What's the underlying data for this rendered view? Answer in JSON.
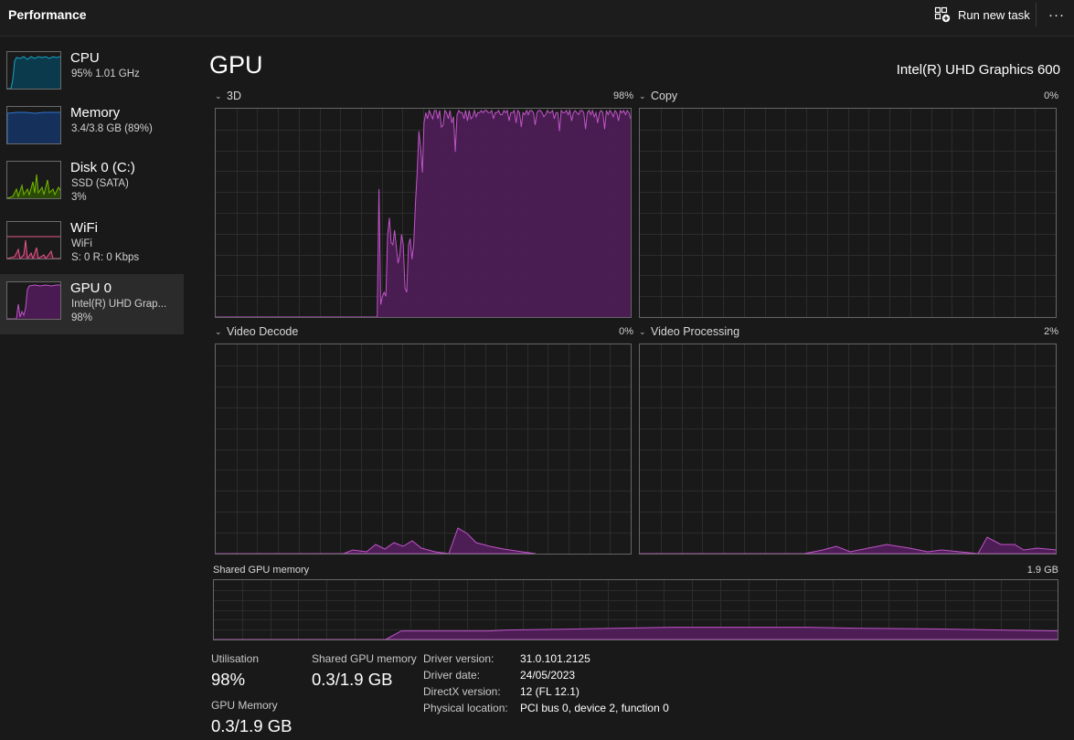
{
  "header": {
    "title": "Performance",
    "run_new_task": "Run new task",
    "more": "···",
    "run_icon": "run-task-icon",
    "more_icon": "more-options-icon"
  },
  "sidebar": {
    "items": [
      {
        "name": "CPU",
        "line1": "95% 1.01 GHz",
        "line2": "",
        "color": "#17a2c7"
      },
      {
        "name": "Memory",
        "line1": "3.4/3.8 GB (89%)",
        "line2": "",
        "color": "#2f74d1"
      },
      {
        "name": "Disk 0 (C:)",
        "line1": "SSD (SATA)",
        "line2": "3%",
        "color": "#76b900"
      },
      {
        "name": "WiFi",
        "line1": "WiFi",
        "line2": "S: 0 R: 0 Kbps",
        "color": "#e45a8b"
      },
      {
        "name": "GPU 0",
        "line1": "Intel(R) UHD Grap...",
        "line2": "98%",
        "color": "#c054c8"
      }
    ]
  },
  "main": {
    "title": "GPU",
    "model": "Intel(R) UHD Graphics 600",
    "accent": "#c054c8",
    "graphs": [
      {
        "title": "3D",
        "percent": "98%",
        "values": [
          0,
          0,
          0,
          0,
          0,
          0,
          0,
          0,
          0,
          0,
          0,
          0,
          0,
          0,
          0,
          0,
          0,
          0,
          0,
          0,
          0,
          0,
          0,
          0,
          0,
          0,
          0,
          0,
          0,
          0,
          0,
          0,
          0,
          0,
          0,
          0,
          0,
          0,
          0,
          0,
          0,
          0,
          0,
          0,
          0,
          0,
          0,
          0,
          0,
          0,
          0,
          0,
          0,
          0,
          0,
          0,
          0,
          0,
          0,
          0,
          0,
          0,
          0,
          0,
          0,
          0,
          0,
          0,
          0,
          0,
          0,
          0,
          0,
          0,
          0,
          0,
          0,
          0,
          0,
          0,
          0,
          0,
          0,
          0,
          0,
          0,
          0,
          0,
          0,
          0,
          0,
          0,
          0,
          0,
          62,
          6,
          10,
          12,
          10,
          40,
          48,
          36,
          35,
          42,
          34,
          26,
          30,
          40,
          35,
          14,
          12,
          35,
          38,
          28,
          35,
          55,
          70,
          90,
          82,
          70,
          94,
          99,
          96,
          100,
          98,
          96,
          100,
          100,
          96,
          100,
          92,
          93,
          100,
          99,
          96,
          100,
          94,
          97,
          80,
          98,
          100,
          99,
          99,
          96,
          100,
          95,
          100,
          96,
          97,
          100,
          97,
          99,
          99,
          100,
          99,
          100,
          100,
          99,
          99,
          100,
          96,
          99,
          99,
          100,
          98,
          98,
          100,
          99,
          100,
          95,
          99,
          99,
          100,
          94,
          100,
          99,
          92,
          99,
          98,
          100,
          98,
          100,
          100,
          99,
          93,
          99,
          100,
          100,
          99,
          97,
          98,
          100,
          99,
          99,
          100,
          96,
          99,
          99,
          90,
          100,
          99,
          99,
          100,
          98,
          100,
          95,
          99,
          100,
          99,
          98,
          100,
          100,
          99,
          91,
          99,
          100,
          98,
          100,
          97,
          99,
          94,
          99,
          100,
          99,
          91,
          100,
          98,
          100,
          99,
          97,
          100,
          99,
          95,
          100,
          99,
          100,
          98,
          100,
          99,
          96
        ]
      },
      {
        "title": "Copy",
        "percent": "0%",
        "values": []
      },
      {
        "title": "Video Decode",
        "percent": "0%",
        "values": [
          0,
          0,
          0,
          0,
          0,
          0,
          0,
          0,
          0,
          0,
          0,
          0,
          0,
          0,
          0,
          0,
          0,
          0,
          0,
          0,
          0,
          0,
          0,
          0,
          0,
          0,
          0,
          0,
          0,
          0,
          0,
          0,
          0,
          0,
          0,
          0,
          0,
          0,
          0,
          0,
          0,
          0,
          0,
          0,
          0,
          0,
          0,
          0,
          0,
          0,
          0,
          0,
          0,
          0,
          0,
          0,
          0,
          0,
          0,
          0,
          0,
          0,
          0,
          0,
          0,
          0,
          0,
          0,
          0,
          0,
          0,
          0,
          0,
          0,
          0,
          0,
          0,
          0,
          0,
          0,
          0,
          0,
          0,
          0,
          0,
          0,
          0,
          0,
          0,
          0,
          0,
          0,
          0,
          0,
          0,
          0,
          0,
          0,
          0,
          0,
          0,
          0,
          0,
          0,
          0,
          0,
          0,
          0,
          0,
          0,
          0,
          0,
          0,
          0,
          0,
          0,
          0,
          0,
          0,
          0,
          0,
          0,
          0,
          0,
          0,
          0,
          0,
          0,
          0,
          0,
          0,
          0,
          0,
          0,
          0,
          0,
          0,
          0,
          0,
          0,
          0,
          0,
          0,
          0,
          0,
          0,
          0,
          0,
          0,
          0,
          0,
          0,
          0,
          0,
          0,
          0,
          0,
          0,
          0,
          0,
          0,
          0,
          0,
          0,
          0,
          0,
          0,
          0,
          0,
          0,
          0,
          0,
          0,
          0,
          0,
          0,
          0,
          0,
          0,
          0,
          0,
          0,
          0,
          0,
          0,
          0,
          0,
          0,
          0,
          0,
          0,
          0,
          0,
          0,
          0,
          0,
          0,
          0,
          0,
          0,
          0,
          0,
          0,
          0,
          0,
          0,
          0,
          0,
          0,
          0,
          0,
          0,
          0,
          0,
          0,
          0,
          0,
          0,
          0,
          0,
          0,
          0,
          0,
          0,
          0,
          0,
          0,
          0,
          0,
          0,
          0,
          0,
          0,
          0,
          0,
          0,
          0,
          0,
          0,
          0,
          0,
          0,
          0,
          0,
          0,
          0,
          0,
          0,
          0,
          0,
          0,
          0,
          0,
          0,
          0,
          0
        ]
      },
      {
        "title": "Video Processing",
        "percent": "2%",
        "values": []
      }
    ],
    "shared_memory_graph": {
      "title": "Shared GPU memory",
      "max": "1.9 GB"
    },
    "stats": {
      "utilisation_label": "Utilisation",
      "utilisation_value": "98%",
      "shared_label": "Shared GPU memory",
      "shared_value": "0.3/1.9 GB",
      "gpu_memory_label": "GPU Memory",
      "gpu_memory_value": "0.3/1.9 GB"
    },
    "info": [
      {
        "label": "Driver version:",
        "value": "31.0.101.2125"
      },
      {
        "label": "Driver date:",
        "value": "24/05/2023"
      },
      {
        "label": "DirectX version:",
        "value": "12 (FL 12.1)"
      },
      {
        "label": "Physical location:",
        "value": "PCI bus 0, device 2, function 0"
      }
    ]
  }
}
